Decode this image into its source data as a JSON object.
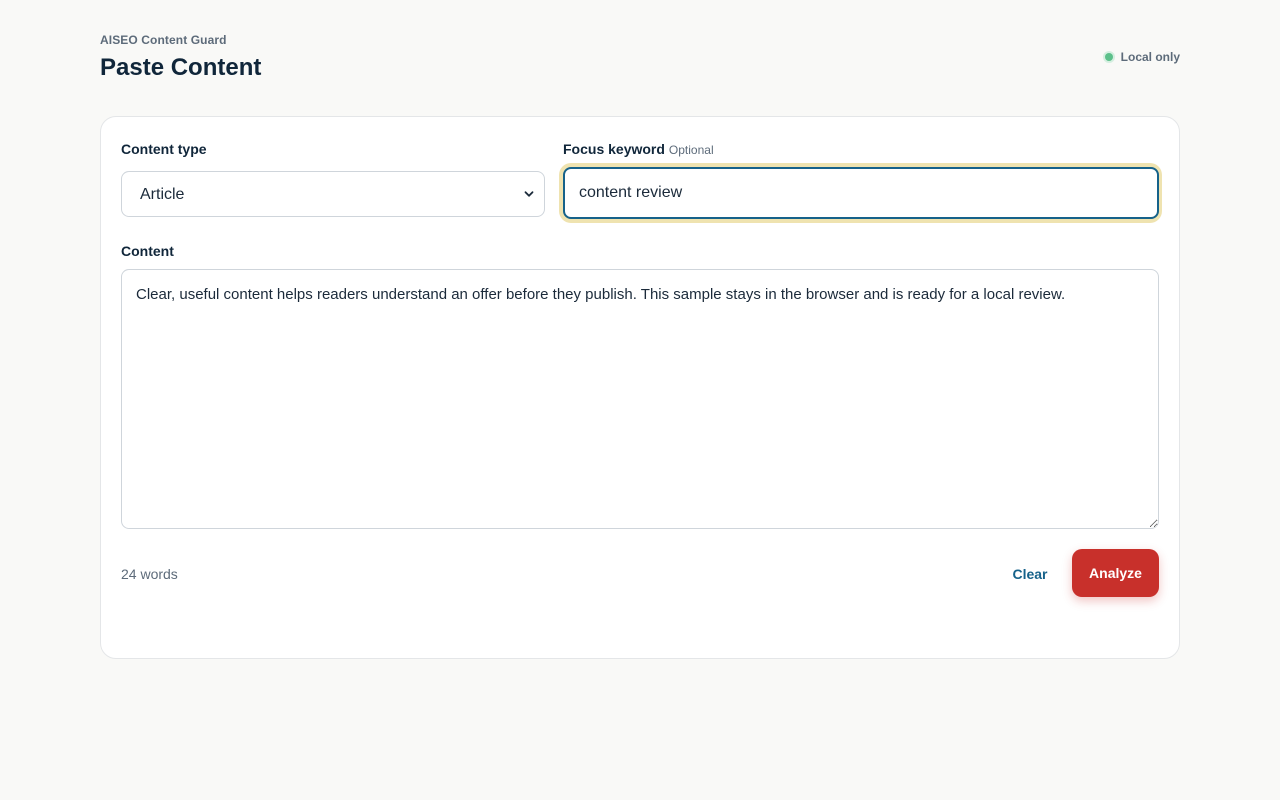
{
  "header": {
    "app_name": "AISEO Content Guard",
    "page_title": "Paste Content",
    "status_text": "Local only",
    "status_color": "#5cc08a"
  },
  "form": {
    "content_type": {
      "label": "Content type",
      "selected": "Article"
    },
    "focus_keyword": {
      "label": "Focus keyword",
      "optional_tag": "Optional",
      "value": "content review"
    },
    "content": {
      "label": "Content",
      "value": "Clear, useful content helps readers understand an offer before they publish. This sample stays in the browser and is ready for a local review."
    },
    "word_count": "24 words",
    "clear_label": "Clear",
    "analyze_label": "Analyze"
  },
  "colors": {
    "accent": "#16628a",
    "primary_button": "#c8302b",
    "focus_ring": "#efe3b0",
    "background": "#f9f9f7"
  },
  "icons": {
    "select_arrow": "chevron-down-icon",
    "status": "status-dot-icon"
  }
}
